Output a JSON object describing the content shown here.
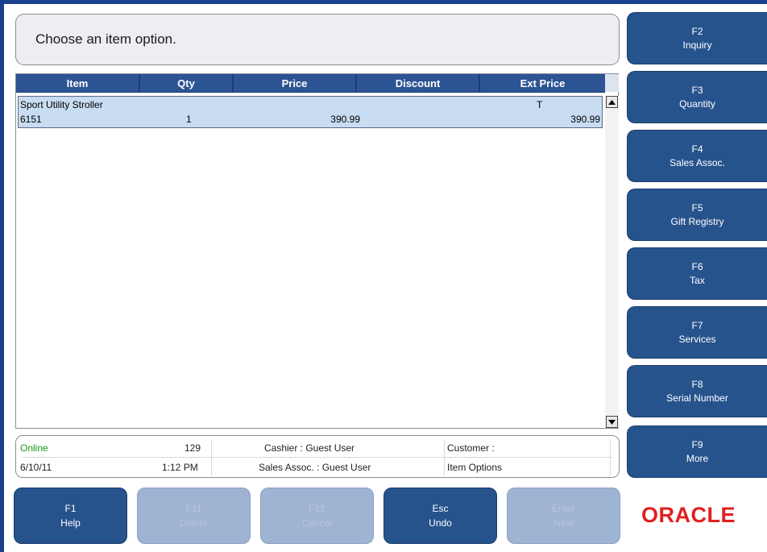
{
  "prompt": {
    "text": "Choose an item option."
  },
  "table": {
    "columns": [
      "Item",
      "Qty",
      "Price",
      "Discount",
      "Ext Price"
    ],
    "rows": [
      {
        "description": "Sport Utility Stroller",
        "tax_flag": "T",
        "item_id": "6151",
        "qty": "1",
        "price": "390.99",
        "discount": "",
        "ext_price": "390.99"
      }
    ]
  },
  "status": {
    "connection": "Online",
    "register": "129",
    "cashier": "Cashier : Guest User",
    "customer": "Customer :",
    "date": "6/10/11",
    "time": "1:12 PM",
    "sales_assoc": "Sales Assoc. : Guest User",
    "mode": "Item Options"
  },
  "side_buttons": [
    {
      "key": "F2",
      "label": "Inquiry"
    },
    {
      "key": "F3",
      "label": "Quantity"
    },
    {
      "key": "F4",
      "label": "Sales Assoc."
    },
    {
      "key": "F5",
      "label": "Gift Registry"
    },
    {
      "key": "F6",
      "label": "Tax"
    },
    {
      "key": "F7",
      "label": "Services"
    },
    {
      "key": "F8",
      "label": "Serial Number"
    },
    {
      "key": "F9",
      "label": "More"
    }
  ],
  "bottom_buttons": [
    {
      "key": "F1",
      "label": "Help",
      "enabled": true
    },
    {
      "key": "F11",
      "label": "Delete",
      "enabled": false
    },
    {
      "key": "F12",
      "label": "Cancel",
      "enabled": false
    },
    {
      "key": "Esc",
      "label": "Undo",
      "enabled": true
    },
    {
      "key": "Enter",
      "label": "Next",
      "enabled": false
    }
  ],
  "logo": {
    "text": "ORACLE"
  },
  "colors": {
    "frame": "#1a3f8c",
    "button": "#27538d",
    "button_disabled": "#9fb3d2",
    "header": "#2c5494",
    "selected_row": "#c8dcf2",
    "online_status": "#1a9a1a",
    "logo": "#e02020"
  },
  "icons": {
    "scroll_up": "triangle-up-icon",
    "scroll_down": "triangle-down-icon"
  }
}
